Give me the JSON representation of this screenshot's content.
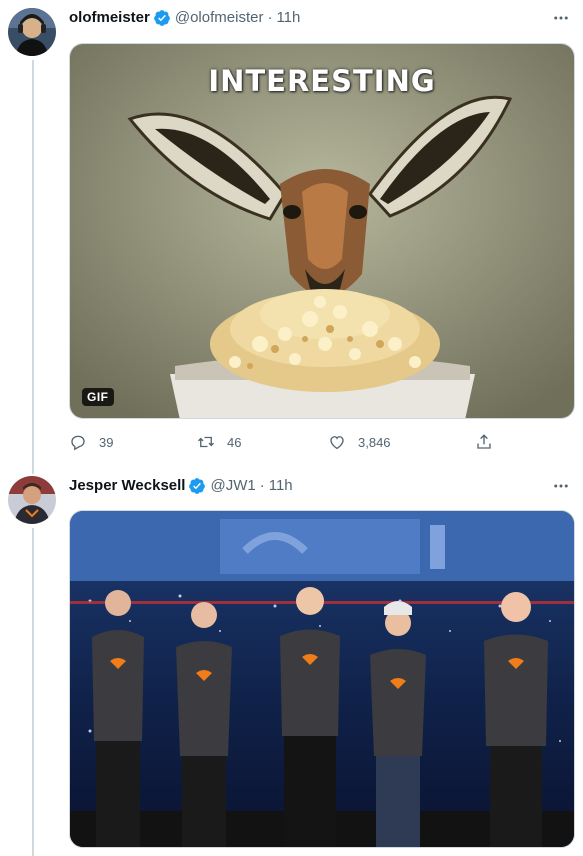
{
  "tweets": [
    {
      "display_name": "olofmeister",
      "handle": "@olofmeister",
      "time": "11h",
      "media": {
        "type": "gif",
        "caption": "INTERESTING",
        "badge": "GIF"
      },
      "stats": {
        "replies": "39",
        "retweets": "46",
        "likes": "3,846"
      }
    },
    {
      "display_name": "Jesper Wecksell",
      "handle": "@JW1",
      "time": "11h",
      "media": {
        "type": "photo"
      }
    }
  ],
  "separator": "·",
  "colors": {
    "verified": "#1d9bf0",
    "secondary_text": "#536471",
    "thread_line": "#cfd9de"
  },
  "icons": [
    "verified-badge-icon",
    "more-icon",
    "reply-icon",
    "retweet-icon",
    "like-icon",
    "share-icon"
  ]
}
